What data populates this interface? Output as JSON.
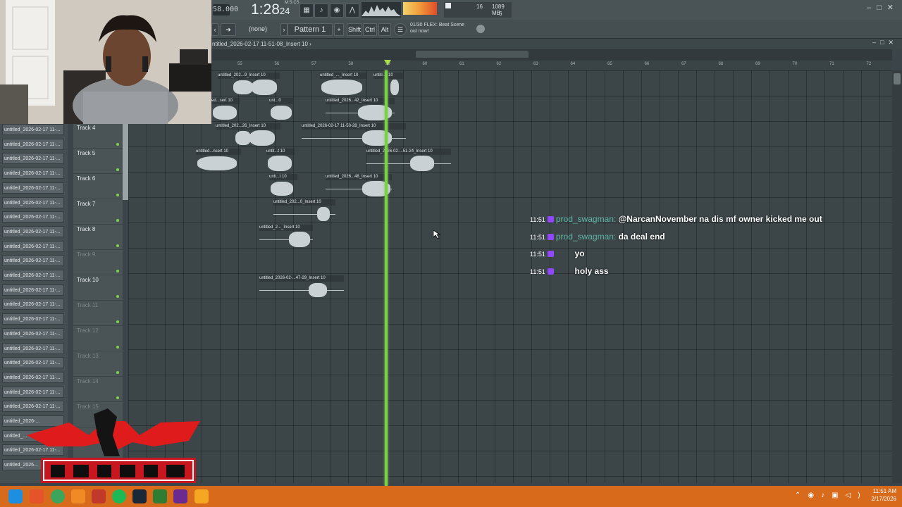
{
  "toolbar": {
    "bpm_fragment": "58.000",
    "time": "1:28",
    "time_sub": "24",
    "time_caption": "M:S:CS",
    "cpu_value": "16",
    "mem_value": "1089 MB",
    "voices": "6"
  },
  "toolbar2": {
    "pattern_none": "(none)",
    "pattern": "Pattern 1",
    "shift": "Shift",
    "ctrl": "Ctrl",
    "alt": "Alt",
    "hint_line1": "01/30  FLEX: Beat Scene",
    "hint_line2": "out now!"
  },
  "playlist": {
    "title": "ntitled_2026-02-17 11-51-08_Insert 10 ›",
    "ruler_numbers": [
      "55",
      "56",
      "57",
      "58",
      "59",
      "60",
      "61",
      "62",
      "63",
      "64",
      "65",
      "66",
      "67",
      "68",
      "69",
      "70",
      "71",
      "72"
    ]
  },
  "browser_items": [
    "untitled_2026-02-17 11-...",
    "untitled_2026-02-17 11-...",
    "untitled_2026-02-17 11-...",
    "untitled_2026-02-17 11-...",
    "untitled_2026-02-17 11-...",
    "untitled_2026-02-17 11-...",
    "untitled_2026-02-17 11-...",
    "untitled_2026-02-17 11-...",
    "untitled_2026-02-17 11-...",
    "untitled_2026-02-17 11-...",
    "untitled_2026-02-17 11-...",
    "untitled_2026-02-17 11-...",
    "untitled_2026-02-17 11-...",
    "untitled_2026-02-17 11-...",
    "untitled_2026-02-17 11-...",
    "untitled_2026-02-17 11-...",
    "untitled_2026-02-17 11-...",
    "untitled_2026-02-17 11-...",
    "untitled_2026-02-17 11-...",
    "untitled_2026-02-17 11-...",
    "untitled_2026-...",
    "untitled_...",
    "untitled_2026-02-17 11-...",
    "untitled_2026..."
  ],
  "tracks": [
    {
      "name": "Track 4",
      "dim": false
    },
    {
      "name": "Track 5",
      "dim": false
    },
    {
      "name": "Track 6",
      "dim": false
    },
    {
      "name": "Track 7",
      "dim": false
    },
    {
      "name": "Track 8",
      "dim": false
    },
    {
      "name": "Track 9",
      "dim": true
    },
    {
      "name": "Track 10",
      "dim": false
    },
    {
      "name": "Track 11",
      "dim": true
    },
    {
      "name": "Track 12",
      "dim": true
    },
    {
      "name": "Track 13",
      "dim": true
    },
    {
      "name": "Track 14",
      "dim": true
    },
    {
      "name": "Track 15",
      "dim": true
    }
  ],
  "clip_labels": {
    "c1": "untitled_202...9_Insert 10",
    "c2": "untitled_..._Insert 10",
    "c3": "untitl...t 10",
    "c4": "ed...sert 10",
    "c5": "unt...0",
    "c6": "untitled_2026...42_Insert 10",
    "c7": "untitled_202...26_Insert 10",
    "c8": "untitled_2026-02-17 11-50-28_Insert 10",
    "c9": "untitled...nsert 10",
    "c10": "untit...t 10",
    "c11": "untitled_2026-02-...51-24_Insert 10",
    "c12": "unti...t 10",
    "c13": "untitled_2026...48_Insert 10",
    "c14": "untitled_202...0_Insert 10",
    "c15": "untitled_2..._Insert 10",
    "c16": "untitled_2026-02-...47-29_Insert 10"
  },
  "chat": [
    {
      "time": "11:51",
      "user": "prod_swagman",
      "user_color": "#5fb7a6",
      "message": "@NarcanNovember na dis mf owner kicked me out"
    },
    {
      "time": "11:51",
      "user": "prod_swagman",
      "user_color": "#5fb7a6",
      "message": "da deal end"
    },
    {
      "time": "11:51",
      "user": "",
      "user_color": "#b0147a",
      "message": "yo"
    },
    {
      "time": "11:51",
      "user": "",
      "user_color": "#b0147a",
      "message": "holy ass"
    }
  ],
  "taskbar": {
    "clock_time": "11:51 AM",
    "clock_date": "2/17/2026"
  },
  "colors": {
    "playhead": "#7ad04a",
    "taskbar": "#d86a1c",
    "twitch_badge": "#9147ff"
  }
}
